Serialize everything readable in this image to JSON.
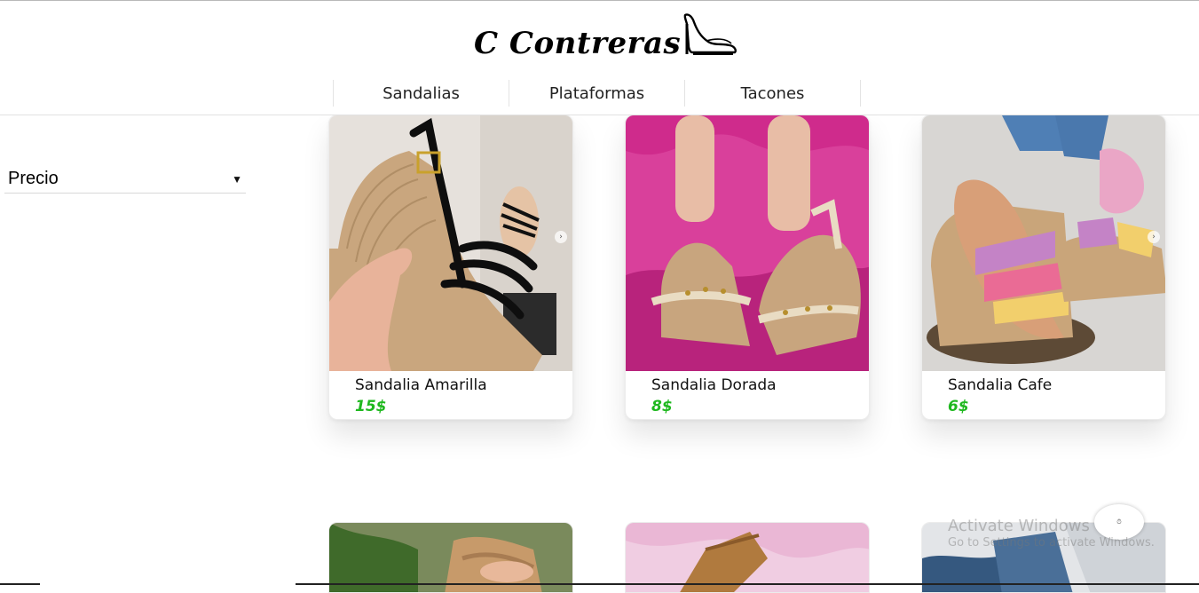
{
  "header": {
    "brand": "C Contreras",
    "logo_icon": "high-heel-shoe-icon",
    "nav": [
      {
        "label": "Sandalias"
      },
      {
        "label": "Plataformas"
      },
      {
        "label": "Tacones"
      }
    ]
  },
  "filters": {
    "sort_select": {
      "value": "Precio"
    }
  },
  "products": [
    {
      "name": "Sandalia Amarilla",
      "price": "15$"
    },
    {
      "name": "Sandalia Dorada",
      "price": "8$"
    },
    {
      "name": "Sandalia Cafe",
      "price": "6$"
    }
  ],
  "colors": {
    "price": "#1fb81f",
    "card_border": "#ececec",
    "nav_divider": "#e3e3e3"
  },
  "overlay": {
    "line1": "Activate Windows",
    "line2": "Go to Settings to activate Windows."
  }
}
